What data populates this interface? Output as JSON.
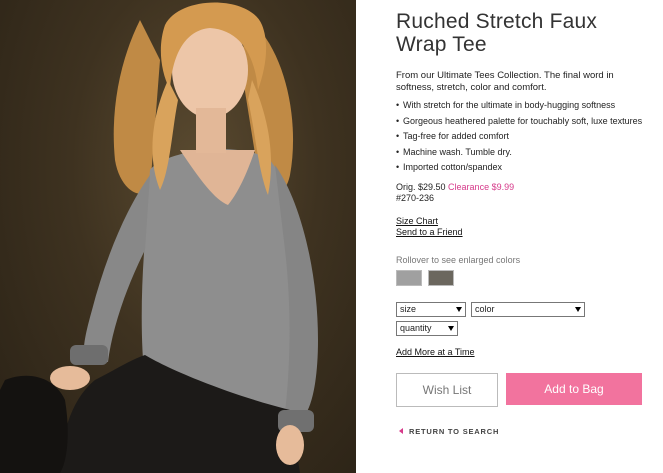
{
  "product": {
    "title": "Ruched Stretch Faux Wrap Tee",
    "description": "From our Ultimate Tees Collection. The final word in softness, stretch, color and comfort.",
    "features": [
      "With stretch for the ultimate in body-hugging softness",
      "Gorgeous heathered palette for touchably soft, luxe textures",
      "Tag-free for added comfort",
      "Machine wash. Tumble dry.",
      "Imported cotton/spandex"
    ],
    "orig_price": "Orig. $29.50",
    "clearance_price": "Clearance $9.99",
    "sku": "#270-236"
  },
  "links": {
    "size_chart": "Size Chart",
    "send_to_friend": "Send to a Friend",
    "add_more": "Add More at a Time",
    "return_to_search": "RETURN TO SEARCH"
  },
  "colors": {
    "rollover_label": "Rollover to see enlarged colors",
    "swatches": [
      "#a0a0a0",
      "#6b675e"
    ]
  },
  "selects": {
    "size": "size",
    "color": "color",
    "quantity": "quantity"
  },
  "buttons": {
    "wish_list": "Wish List",
    "add_to_bag": "Add to Bag"
  },
  "theme": {
    "accent": "#d63a8a",
    "bag_button": "#f2739e"
  }
}
